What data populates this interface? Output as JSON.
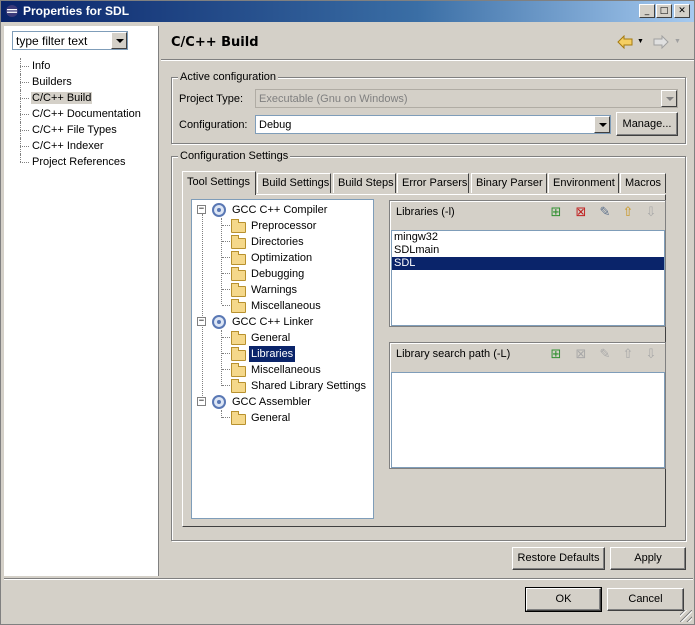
{
  "window": {
    "title": "Properties for SDL"
  },
  "filter": {
    "text": "type filter text"
  },
  "nav": {
    "items": [
      {
        "label": "Info"
      },
      {
        "label": "Builders"
      },
      {
        "label": "C/C++ Build"
      },
      {
        "label": "C/C++ Documentation"
      },
      {
        "label": "C/C++ File Types"
      },
      {
        "label": "C/C++ Indexer"
      },
      {
        "label": "Project References"
      }
    ],
    "selected": "C/C++ Build"
  },
  "header": {
    "title": "C/C++ Build"
  },
  "active_config": {
    "legend": "Active configuration",
    "project_type_label": "Project Type:",
    "project_type_value": "Executable (Gnu on Windows)",
    "configuration_label": "Configuration:",
    "configuration_value": "Debug",
    "manage_label": "Manage..."
  },
  "config_settings": {
    "legend": "Configuration Settings",
    "tabs": [
      {
        "label": "Tool Settings"
      },
      {
        "label": "Build Settings"
      },
      {
        "label": "Build Steps"
      },
      {
        "label": "Error Parsers"
      },
      {
        "label": "Binary Parser"
      },
      {
        "label": "Environment"
      },
      {
        "label": "Macros"
      }
    ],
    "active_tab": "Tool Settings"
  },
  "tool_tree": {
    "gcc_cpp_compiler": "GCC C++ Compiler",
    "compiler_children": [
      "Preprocessor",
      "Directories",
      "Optimization",
      "Debugging",
      "Warnings",
      "Miscellaneous"
    ],
    "gcc_cpp_linker": "GCC C++ Linker",
    "linker_children": [
      "General",
      "Libraries",
      "Miscellaneous",
      "Shared Library Settings"
    ],
    "gcc_assembler": "GCC Assembler",
    "assembler_children": [
      "General"
    ],
    "selected": "Libraries"
  },
  "libraries": {
    "title": "Libraries (-l)",
    "items": [
      "mingw32",
      "SDLmain",
      "SDL"
    ],
    "selected": "SDL"
  },
  "library_search_path": {
    "title": "Library search path (-L)",
    "items": []
  },
  "buttons": {
    "restore_defaults": "Restore Defaults",
    "apply": "Apply",
    "ok": "OK",
    "cancel": "Cancel"
  },
  "colors": {
    "selection": "#0a246a",
    "face": "#d4d0c8"
  }
}
